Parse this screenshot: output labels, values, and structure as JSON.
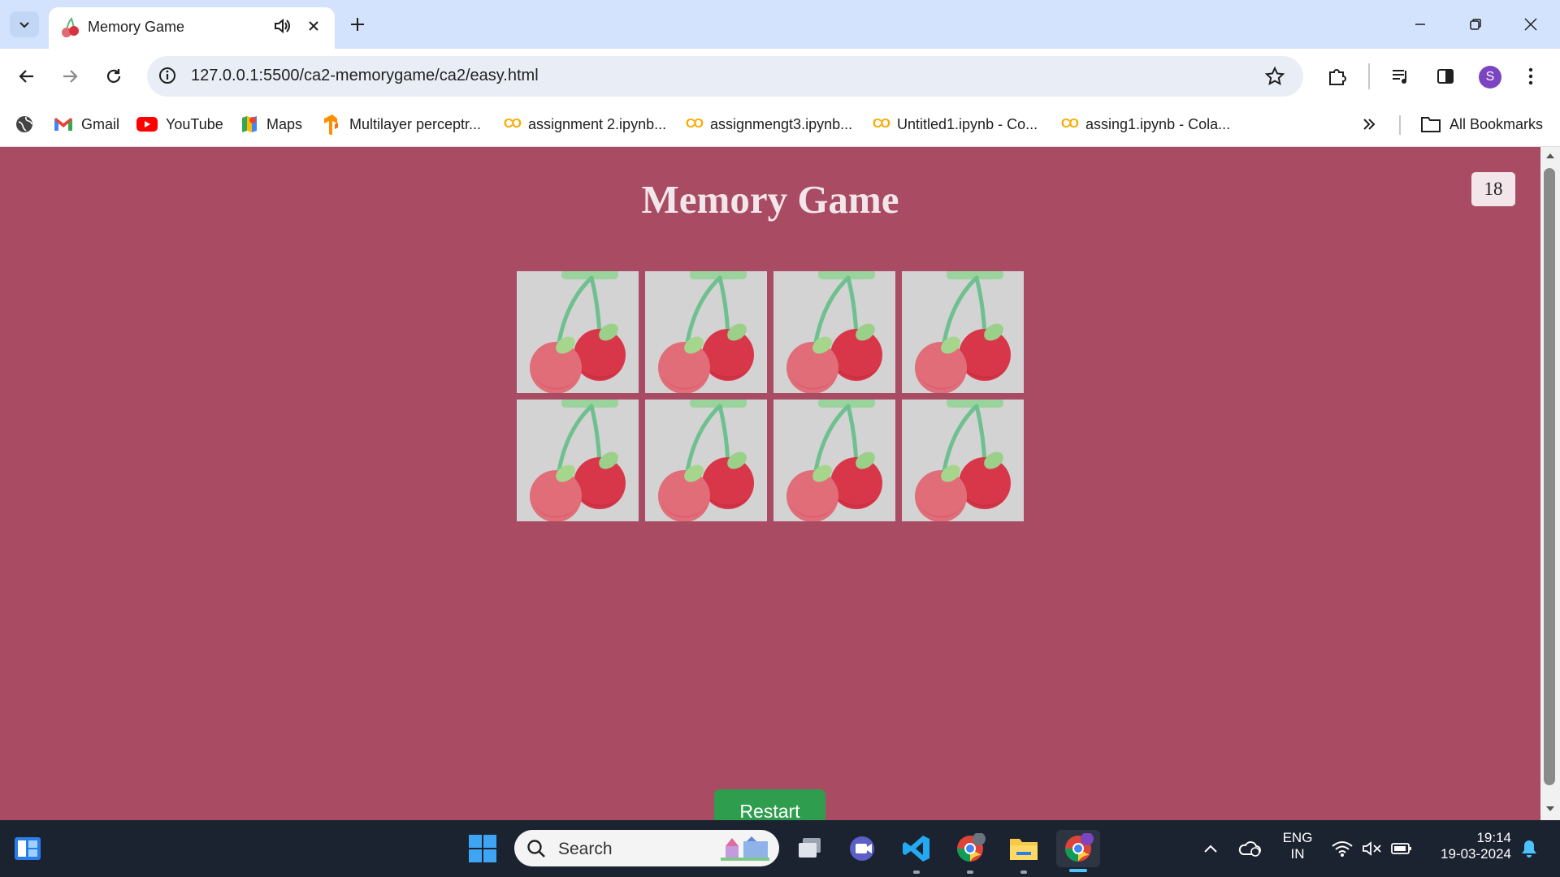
{
  "browser": {
    "tab_title": "Memory Game",
    "url": "127.0.0.1:5500/ca2-memorygame/ca2/easy.html",
    "profile_initial": "S",
    "bookmarks": [
      {
        "label": "Gmail",
        "icon": "gmail-icon"
      },
      {
        "label": "YouTube",
        "icon": "youtube-icon"
      },
      {
        "label": "Maps",
        "icon": "maps-icon"
      },
      {
        "label": "Multilayer perceptr...",
        "icon": "tensorflow-icon"
      },
      {
        "label": "assignment 2.ipynb...",
        "icon": "colab-icon"
      },
      {
        "label": "assignmengt3.ipynb...",
        "icon": "colab-icon"
      },
      {
        "label": "Untitled1.ipynb - Co...",
        "icon": "colab-icon"
      },
      {
        "label": "assing1.ipynb - Cola...",
        "icon": "colab-icon"
      }
    ],
    "all_bookmarks": "All Bookmarks",
    "colab_logo": "CO"
  },
  "game": {
    "title": "Memory Game",
    "score": "18",
    "restart_label": "Restart",
    "cards": [
      "cherry",
      "cherry",
      "cherry",
      "cherry",
      "cherry",
      "cherry",
      "cherry",
      "cherry"
    ]
  },
  "taskbar": {
    "search_placeholder": "Search",
    "lang_top": "ENG",
    "lang_bottom": "IN",
    "time": "19:14",
    "date": "19-03-2024",
    "chrome_profile_badge": "S"
  },
  "colors": {
    "page_bg": "#a84b63",
    "card_bg": "#d3d3d3",
    "restart_bg": "#2e9e4e",
    "accent": "#7b44c1"
  }
}
